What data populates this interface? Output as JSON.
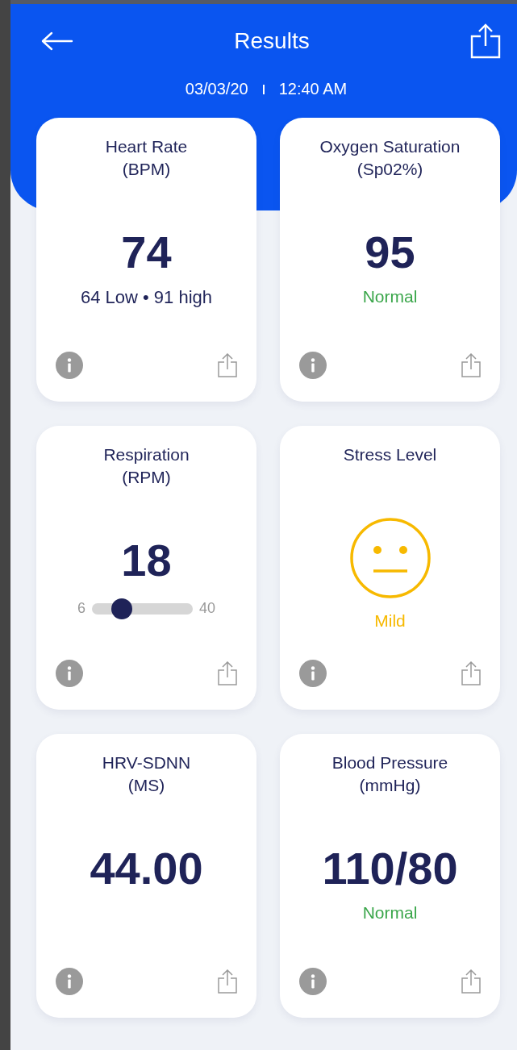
{
  "header": {
    "title": "Results",
    "date": "03/03/20",
    "time": "12:40 AM"
  },
  "cards": [
    {
      "kind": "range",
      "title": "Heart Rate",
      "unit": "(BPM)",
      "value": "74",
      "subline": "64 Low • 91 high"
    },
    {
      "kind": "status",
      "title": "Oxygen Saturation",
      "unit": "(Sp02%)",
      "value": "95",
      "status": "Normal",
      "color": "#3aa64a"
    },
    {
      "kind": "slider",
      "title": "Respiration",
      "unit": "(RPM)",
      "value": "18",
      "min": "6",
      "max": "40",
      "level": 0.3
    },
    {
      "kind": "face",
      "title": "Stress Level",
      "status": "Mild",
      "color": "#f7b900"
    },
    {
      "kind": "plain",
      "title": "HRV-SDNN",
      "unit": "(MS)",
      "value": "44.00"
    },
    {
      "kind": "status",
      "title": "Blood Pressure",
      "unit": "(mmHg)",
      "value": "110/80",
      "status": "Normal",
      "color": "#3aa64a"
    }
  ]
}
